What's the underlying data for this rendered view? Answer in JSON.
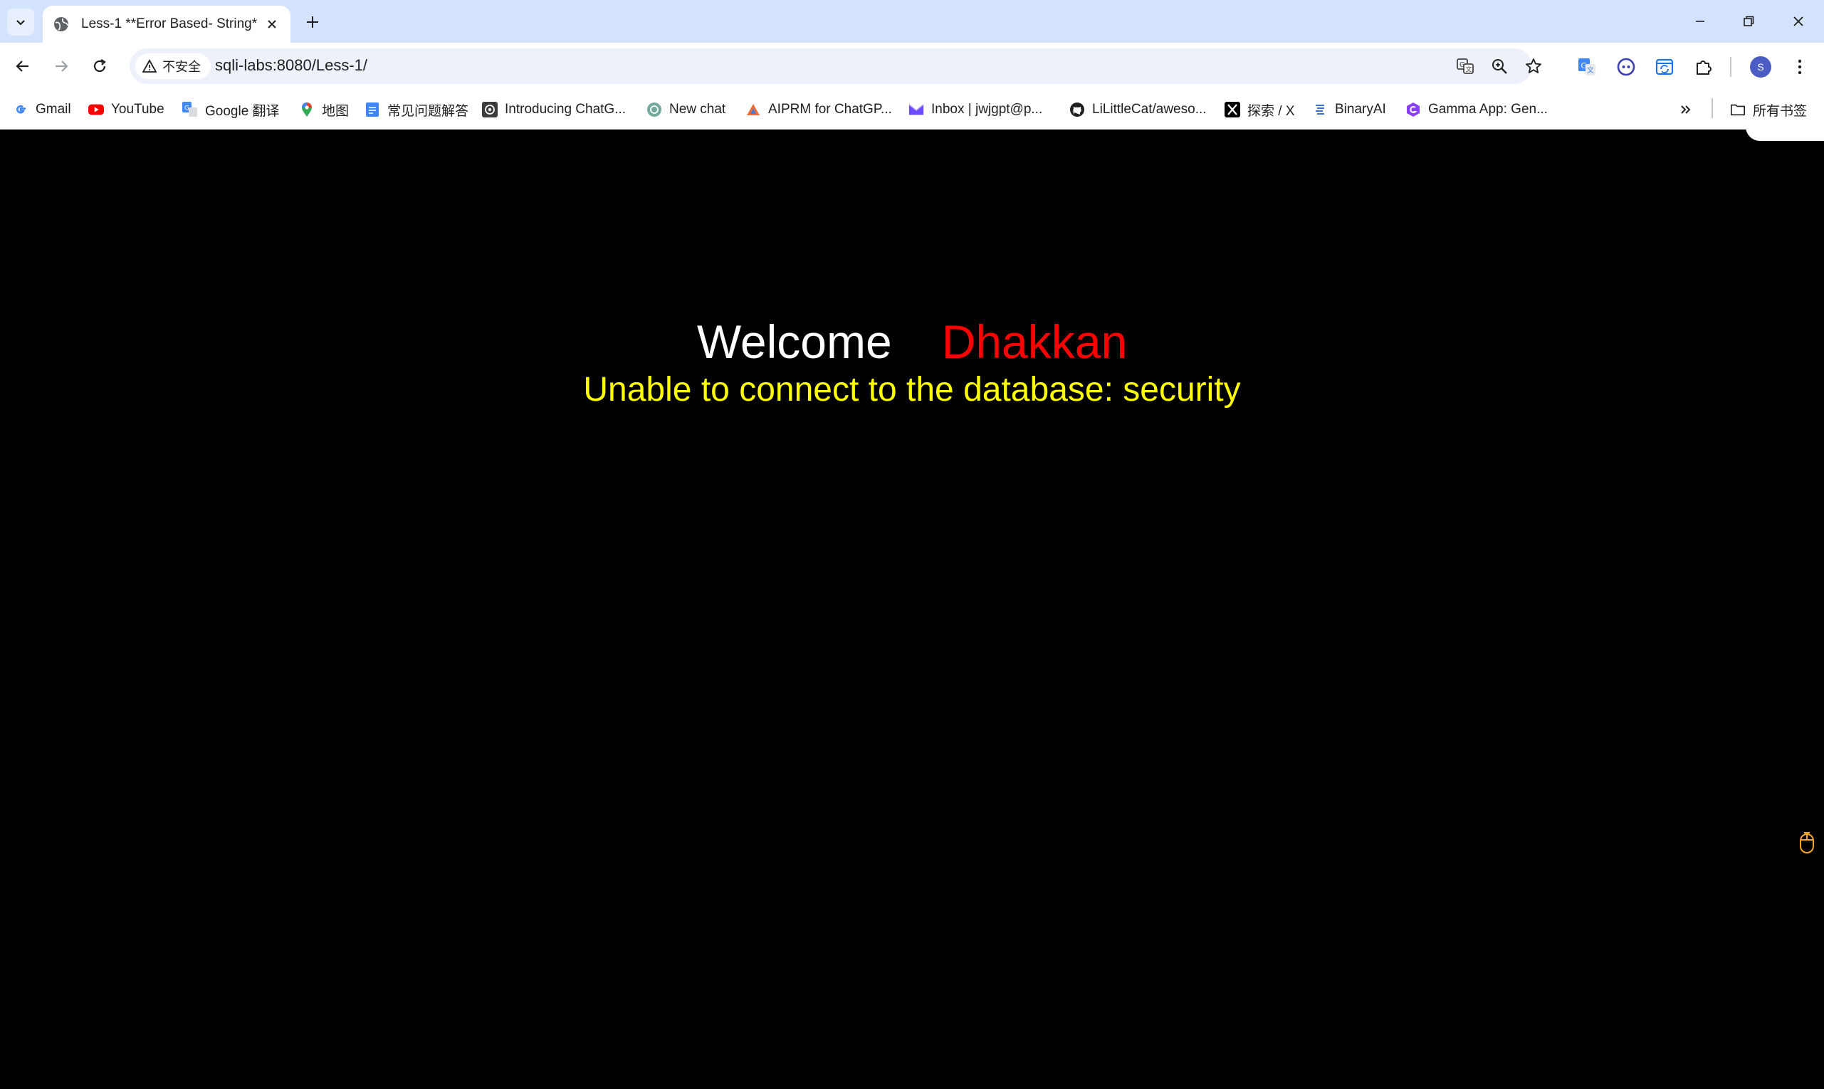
{
  "tabs": [
    {
      "title": "Less-1 **Error Based- String*"
    }
  ],
  "toolbar": {
    "security_label": "不安全",
    "url": "sqli-labs:8080/Less-1/",
    "avatar_letter": "S"
  },
  "bookmarks": [
    {
      "label": "Gmail",
      "icon": "google-g-icon"
    },
    {
      "label": "YouTube",
      "icon": "youtube-icon"
    },
    {
      "label": "Google 翻译",
      "icon": "google-translate-icon"
    },
    {
      "label": "地图",
      "icon": "maps-pin-icon"
    },
    {
      "label": "常见问题解答",
      "icon": "doc-icon"
    },
    {
      "label": "Introducing ChatG...",
      "icon": "openai-icon"
    },
    {
      "label": "New chat",
      "icon": "chatgpt-icon"
    },
    {
      "label": "AIPRM for ChatGP...",
      "icon": "aiprm-icon"
    },
    {
      "label": "Inbox | jwjgpt@p...",
      "icon": "proton-mail-icon"
    },
    {
      "label": "LiLittleCat/aweso...",
      "icon": "github-icon"
    },
    {
      "label": "探索 / X",
      "icon": "x-icon"
    },
    {
      "label": "BinaryAI",
      "icon": "binaryai-icon"
    },
    {
      "label": "Gamma App: Gen...",
      "icon": "gamma-icon"
    }
  ],
  "all_bookmarks_label": "所有书签",
  "page": {
    "welcome": "Welcome",
    "name": "Dhakkan",
    "error": "Unable to connect to the database: security"
  },
  "colors": {
    "page_bg": "#000000",
    "welcome": "#ffffff",
    "name": "#ff0000",
    "error": "#ffff00",
    "tabstrip": "#d3e3fd"
  }
}
